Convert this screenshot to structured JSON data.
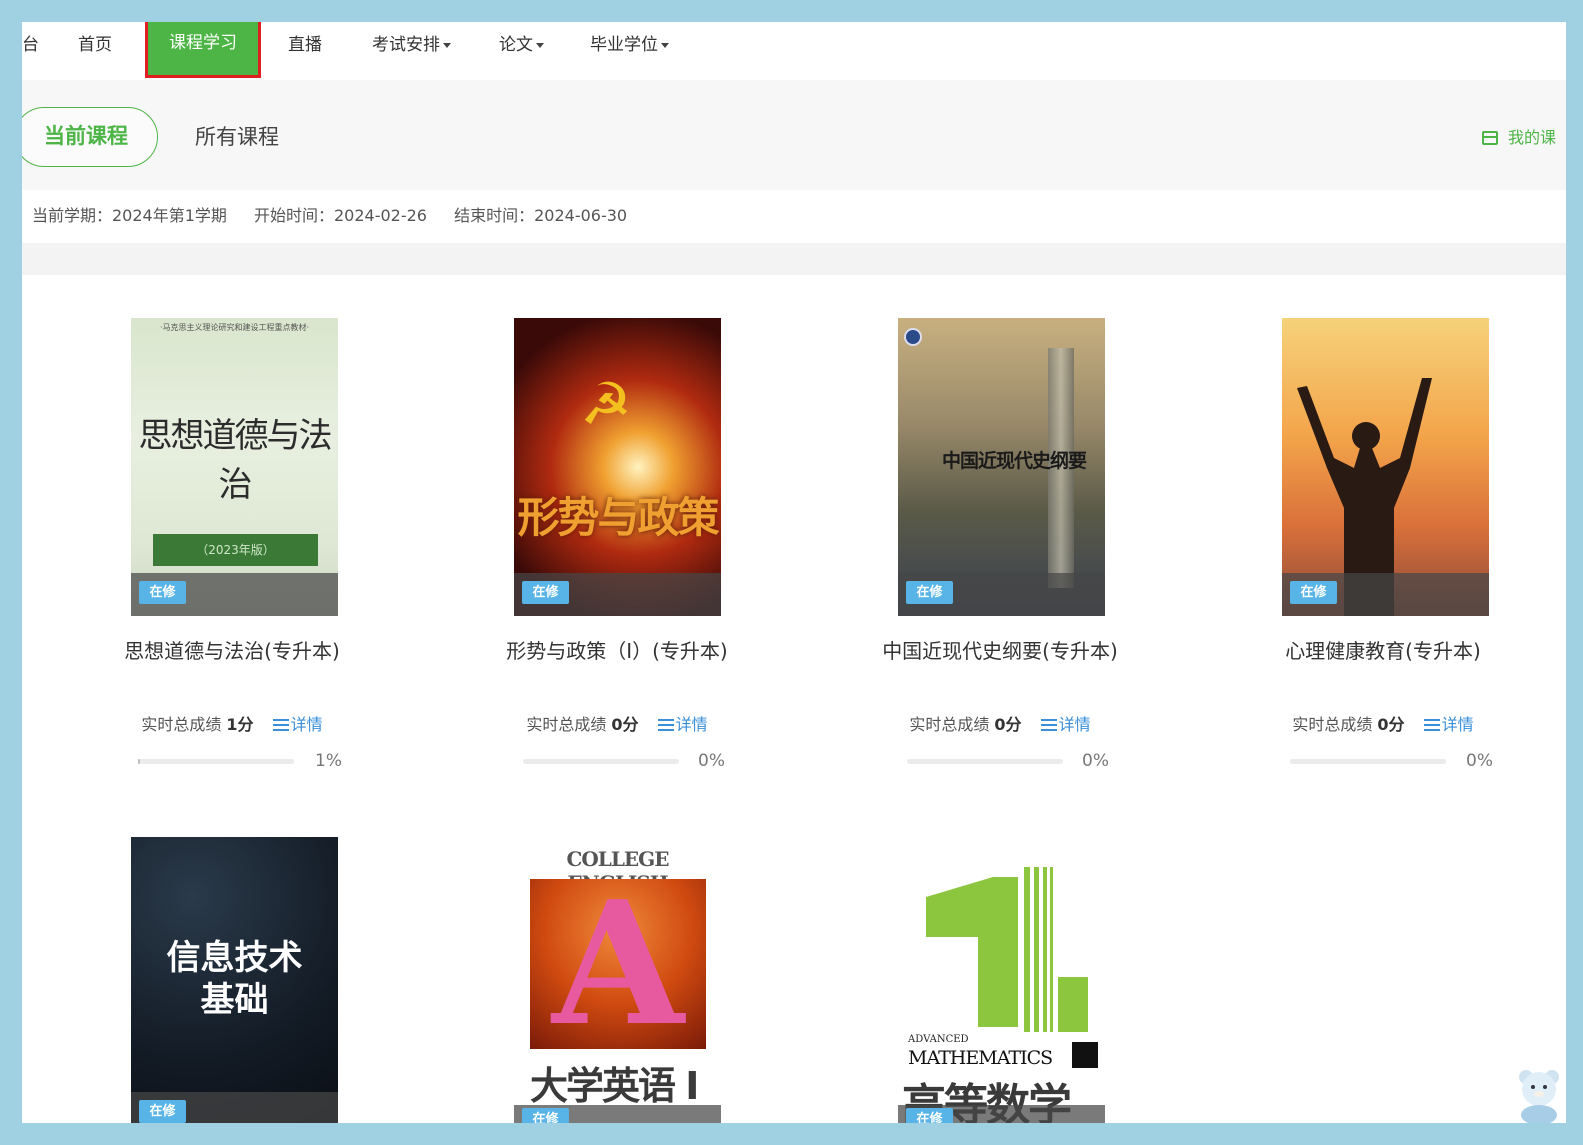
{
  "nav": {
    "partial_left": "台",
    "items": [
      {
        "label": "首页",
        "caret": false
      },
      {
        "label": "课程学习",
        "caret": false,
        "active": true
      },
      {
        "label": "直播",
        "caret": false
      },
      {
        "label": "考试安排",
        "caret": true
      },
      {
        "label": "论文",
        "caret": true
      },
      {
        "label": "毕业学位",
        "caret": true
      }
    ]
  },
  "tabs": {
    "current": "当前课程",
    "all": "所有课程"
  },
  "my_course_link": "我的课",
  "term": {
    "semester": "当前学期：2024年第1学期",
    "start": "开始时间：2024-02-26",
    "end": "结束时间：2024-06-30"
  },
  "badge_label": "在修",
  "score_label": "实时总成绩",
  "detail_label": "详情",
  "courses": [
    {
      "title": "思想道德与法治(专升本)",
      "score": "1分",
      "progress_text": "1%",
      "progress": 1,
      "cover_top": "·马克思主义理论研究和建设工程重点教材·",
      "cover_title": "思想道德与法治",
      "cover_edition": "（2023年版）"
    },
    {
      "title": "形势与政策（I）(专升本)",
      "score": "0分",
      "progress_text": "0%",
      "progress": 0,
      "cover_title": "形势与政策"
    },
    {
      "title": "中国近现代史纲要(专升本)",
      "score": "0分",
      "progress_text": "0%",
      "progress": 0,
      "cover_title": "中国近现代史纲要"
    },
    {
      "title": "心理健康教育(专升本)",
      "score": "0分",
      "progress_text": "0%",
      "progress": 0
    },
    {
      "cover_title": "信息技术基础"
    },
    {
      "cover_top": "COLLEGE ENGLISH",
      "cover_title": "大学英语 I"
    },
    {
      "cover_top": "ADVANCED",
      "cover_sub": "MATHEMATICS",
      "cover_title": "高等数学"
    }
  ],
  "colors": {
    "accent": "#4db546",
    "badge": "#58b4e6",
    "link": "#3a8fd8",
    "frame": "#9fd1e3",
    "active_border": "#e02020"
  }
}
